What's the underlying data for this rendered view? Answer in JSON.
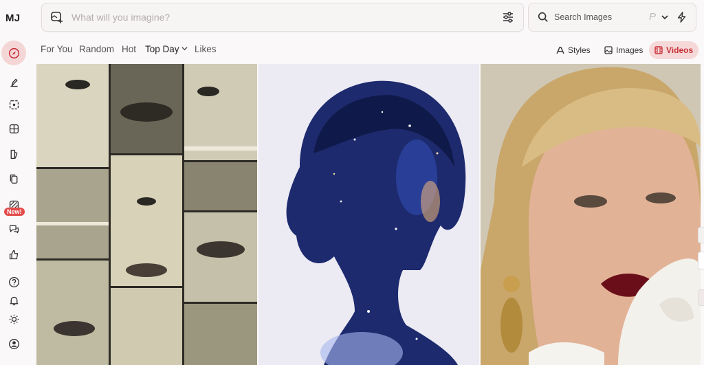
{
  "app": {
    "logo": "MJ"
  },
  "sidebar": {
    "items": [
      {
        "name": "explore",
        "icon": "compass-icon",
        "active": true
      },
      {
        "name": "create",
        "icon": "brush-icon"
      },
      {
        "name": "edit",
        "icon": "edit-icon"
      },
      {
        "name": "organize",
        "icon": "grid-icon"
      },
      {
        "name": "personalize",
        "icon": "palette-icon"
      },
      {
        "name": "moodboards",
        "icon": "copy-icon"
      },
      {
        "name": "new-feature",
        "icon": "stripes-icon",
        "badge": "New!"
      },
      {
        "name": "chat",
        "icon": "chat-icon"
      },
      {
        "name": "likes",
        "icon": "thumbs-up-icon"
      },
      {
        "name": "help",
        "icon": "help-icon"
      },
      {
        "name": "notifications",
        "icon": "bell-icon"
      },
      {
        "name": "theme",
        "icon": "sun-icon"
      },
      {
        "name": "profile",
        "icon": "user-icon"
      }
    ]
  },
  "prompt": {
    "placeholder": "What will you imagine?",
    "icon": "image-add-icon",
    "settings_icon": "sliders-icon"
  },
  "search": {
    "placeholder": "Search Images",
    "p_label": "P",
    "icon": "search-icon"
  },
  "tabs": [
    {
      "label": "For You"
    },
    {
      "label": "Random"
    },
    {
      "label": "Hot"
    },
    {
      "label": "Top Day",
      "active": true,
      "dropdown": true
    },
    {
      "label": "Likes"
    }
  ],
  "view_buttons": [
    {
      "label": "Styles",
      "icon": "styles-icon"
    },
    {
      "label": "Images",
      "icon": "image-icon"
    },
    {
      "label": "Videos",
      "icon": "film-icon",
      "active": true
    }
  ],
  "colors": {
    "accent": "#c8313a",
    "accent_bg": "#f6d8d8",
    "background": "#faf8f8"
  },
  "gallery": [
    {
      "subject": "collage-of-faces"
    },
    {
      "subject": "anime-galaxy-silhouette"
    },
    {
      "subject": "portrait-red-lips"
    }
  ]
}
